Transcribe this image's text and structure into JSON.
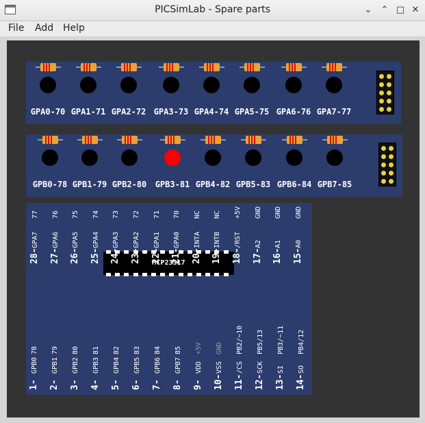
{
  "window": {
    "title": "PICSimLab - Spare parts",
    "minimize": "⌄",
    "restore": "⌃",
    "maximize": "□",
    "close": "✕"
  },
  "menu": [
    "File",
    "Add",
    "Help"
  ],
  "led_bar_a": {
    "labels": [
      "GPA0-70",
      "GPA1-71",
      "GPA2-72",
      "GPA3-73",
      "GPA4-74",
      "GPA5-75",
      "GPA6-76",
      "GPA7-77"
    ],
    "states": [
      0,
      0,
      0,
      0,
      0,
      0,
      0,
      0
    ]
  },
  "led_bar_b": {
    "labels": [
      "GPB0-78",
      "GPB1-79",
      "GPB2-80",
      "GPB3-81",
      "GPB4-82",
      "GPB5-83",
      "GPB6-84",
      "GPB7-85"
    ],
    "states": [
      0,
      0,
      0,
      1,
      0,
      0,
      0,
      0
    ]
  },
  "chip": {
    "name": "MCP23S17",
    "top_pin_numbers": [
      "28-",
      "27-",
      "26-",
      "25-",
      "24-",
      "23-",
      "22-",
      "21-",
      "20-",
      "19-",
      "18-",
      "17-",
      "16-",
      "15-"
    ],
    "top_pin_names": [
      "GPA7",
      "GPA6",
      "GPA5",
      "GPA4",
      "GPA3",
      "GPA2",
      "GPA1",
      "GPA0",
      "INTA",
      "INTB",
      "/RST",
      "A2",
      "A1",
      "A0"
    ],
    "top_pin_signals": [
      "77",
      "76",
      "75",
      "74",
      "73",
      "72",
      "71",
      "70",
      "NC",
      "NC",
      "+5V",
      "GND",
      "GND",
      "GND"
    ],
    "bottom_pin_numbers": [
      "1-",
      "2-",
      "3-",
      "4-",
      "5-",
      "6-",
      "7-",
      "8-",
      "9-",
      "10-",
      "11-",
      "12-",
      "13-",
      "14-"
    ],
    "bottom_pin_names": [
      "GPB0",
      "GPB1",
      "GPB2",
      "GPB3",
      "GPB4",
      "GPB5",
      "GPB6",
      "GPB7",
      "VDD",
      "VSS",
      "/CS",
      "SCK",
      "SI",
      "SO"
    ],
    "bottom_pin_signals": [
      "78",
      "79",
      "80",
      "81",
      "82",
      "83",
      "84",
      "85",
      "+5V",
      "GND",
      "PB2/~10",
      "PB5/13",
      "PB3/~11",
      "PB4/12"
    ],
    "grey_signals": [
      "+5V",
      "GND"
    ]
  },
  "colors": {
    "board": "#2c3c6c",
    "canvas": "#333333",
    "led_off": "#000000",
    "led_on": "#ff0000"
  }
}
